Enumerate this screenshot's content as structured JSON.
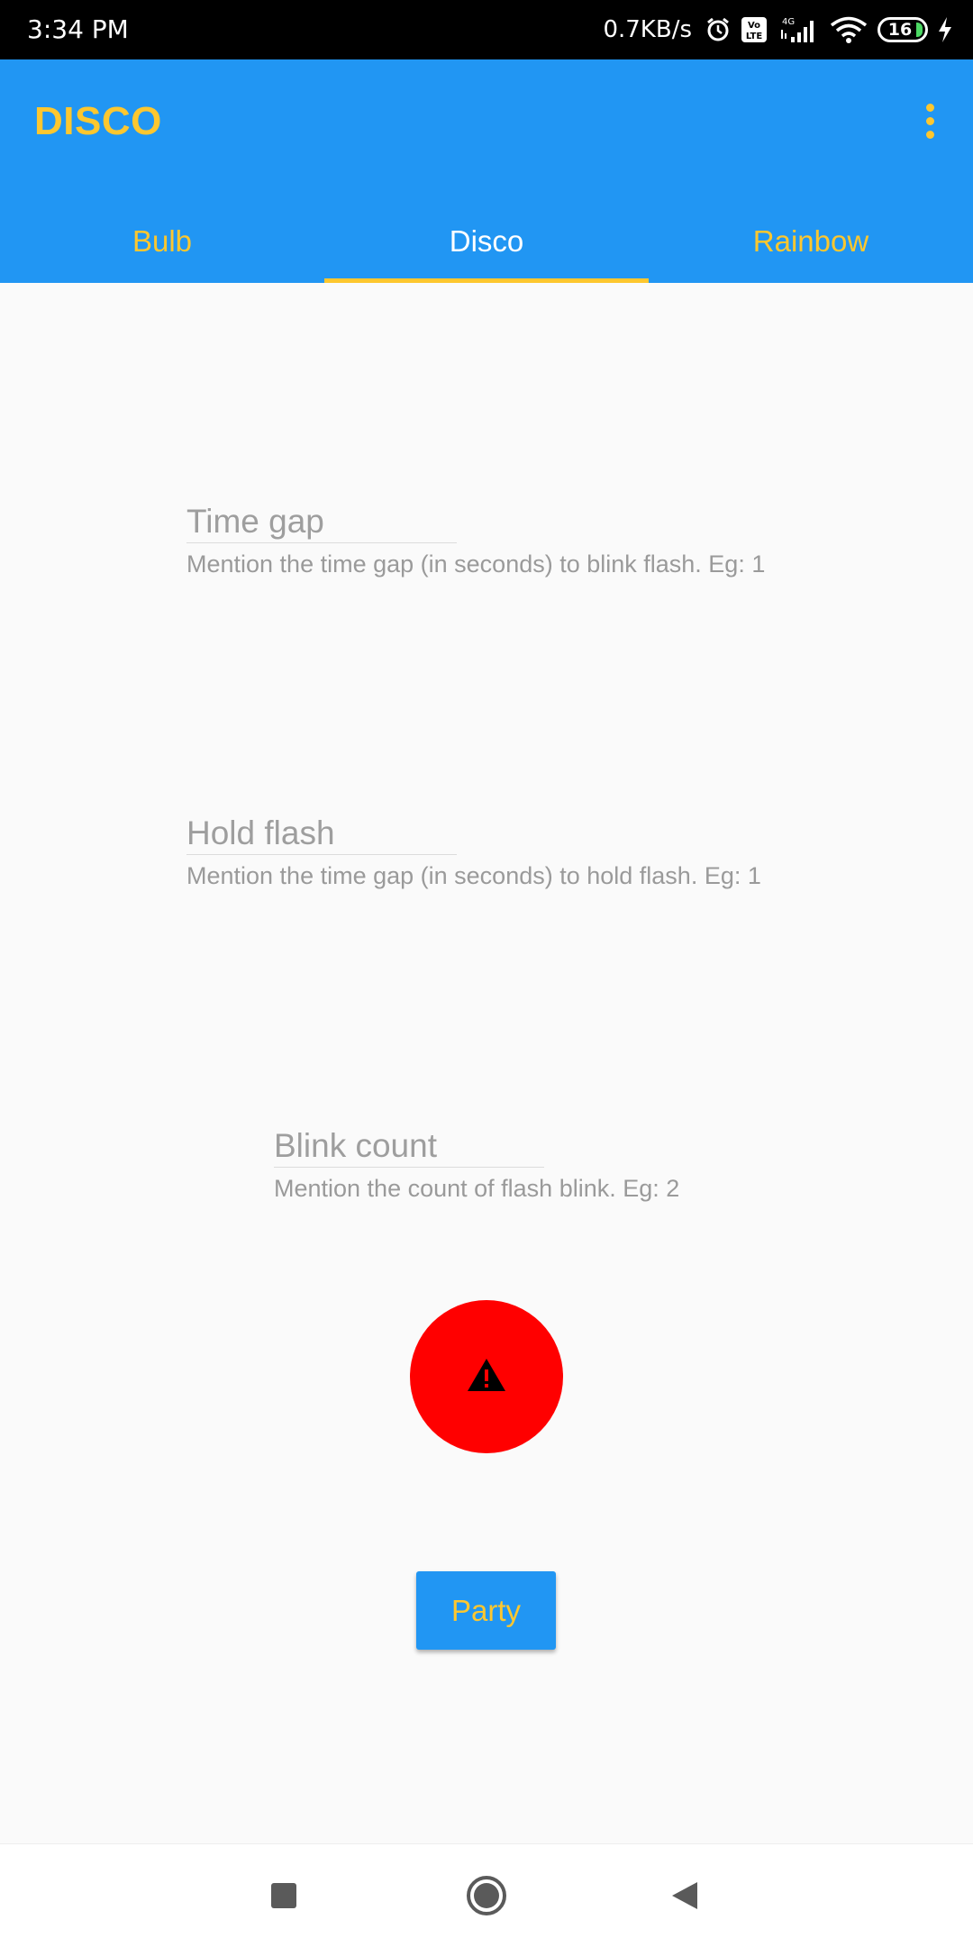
{
  "status_bar": {
    "time": "3:34 PM",
    "net_speed": "0.7KB/s",
    "battery_level": "16",
    "icons": [
      "alarm-icon",
      "volte-icon",
      "signal-4g-icon",
      "wifi-icon",
      "battery-icon",
      "charging-icon"
    ]
  },
  "app_bar": {
    "title": "DISCO",
    "menu_icon": "more-vert-icon"
  },
  "tabs": [
    {
      "label": "Bulb"
    },
    {
      "label": "Disco",
      "active": true
    },
    {
      "label": "Rainbow"
    }
  ],
  "fields": {
    "time_gap": {
      "value": "",
      "placeholder": "Time gap",
      "helper": "Mention the time gap (in seconds) to blink flash. Eg: 1"
    },
    "hold_flash": {
      "value": "",
      "placeholder": "Hold flash",
      "helper": "Mention the time gap (in seconds) to hold flash. Eg: 1"
    },
    "blink_count": {
      "value": "",
      "placeholder": "Blink count",
      "helper": "Mention the count of flash blink. Eg: 2"
    }
  },
  "status_indicator": {
    "icon": "warning-icon",
    "color": "#ff0000"
  },
  "party_button": {
    "label": "Party"
  },
  "colors": {
    "primary": "#2196f3",
    "accent": "#fdc72f",
    "background": "#fafafa"
  },
  "nav_bar": {
    "icons": [
      "recents-icon",
      "home-icon",
      "back-icon"
    ]
  }
}
